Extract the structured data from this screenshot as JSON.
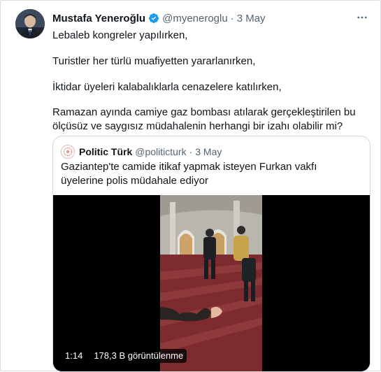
{
  "tweet": {
    "author_name": "Mustafa Yeneroğlu",
    "handle": "@myeneroglu",
    "separator": "·",
    "date": "3 May",
    "verified": true,
    "paragraphs": [
      "Lebaleb kongreler yapılırken,",
      "Turistler her türlü muafiyetten yararlanırken,",
      "İktidar üyeleri kalabalıklarla cenazelere katılırken,",
      "Ramazan ayında camiye gaz bombası atılarak gerçekleştirilen bu ölçüsüz ve saygısız müdahalenin herhangi bir izahı olabilir mi?"
    ]
  },
  "quoted_tweet": {
    "author_name": "Politic Türk",
    "handle": "@politicturk",
    "separator": "·",
    "date": "3 May",
    "text": "Gaziantep'te camide itikaf yapmak isteyen Furkan vakfı üyelerine polis müdahale ediyor",
    "video": {
      "duration": "1:14",
      "views": "178,3 B görüntülenme"
    }
  },
  "colors": {
    "verified_blue": "#1d9bf0",
    "muted_text": "#536471",
    "border": "#cfd9de"
  }
}
